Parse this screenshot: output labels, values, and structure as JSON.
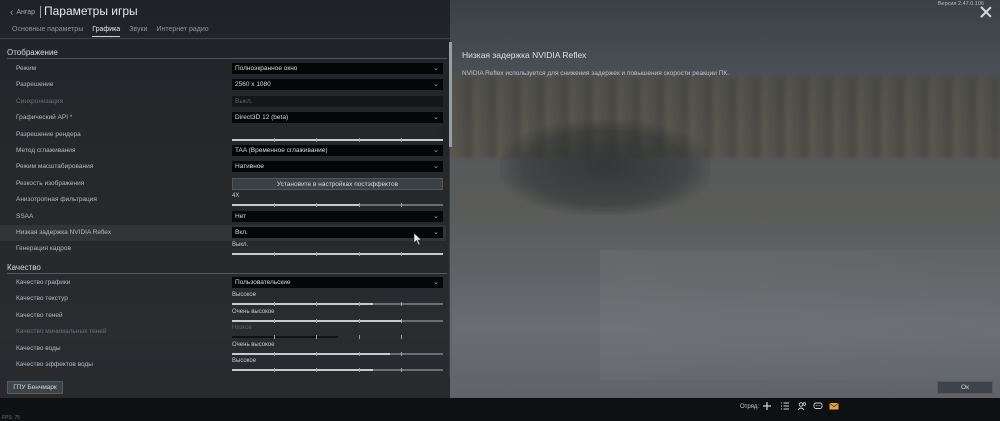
{
  "header": {
    "back_label": "Ангар",
    "title": "Параметры игры",
    "version": "Версия 2.47.0.106",
    "tabs": [
      {
        "label": "Основные параметры",
        "active": false
      },
      {
        "label": "Графика",
        "active": true
      },
      {
        "label": "Звуки",
        "active": false
      },
      {
        "label": "Интернет радио",
        "active": false
      }
    ]
  },
  "display_section": {
    "title": "Отображение",
    "rows": [
      {
        "label": "Режим",
        "type": "select",
        "value": "Полноэкранное окно"
      },
      {
        "label": "Разрешение",
        "type": "select",
        "value": "2560 x 1080"
      },
      {
        "label": "Синхронизация",
        "type": "select-disabled",
        "value": "Выкл."
      },
      {
        "label": "Графический API *",
        "type": "select",
        "value": "Direct3D 12 (beta)"
      },
      {
        "label": "Разрешение рендера",
        "type": "slider",
        "value": "",
        "level": 1.0
      },
      {
        "label": "Метод сглаживания",
        "type": "select",
        "value": "TAA (Временное сглаживание)"
      },
      {
        "label": "Режим масштабирования",
        "type": "select",
        "value": "Нативное"
      },
      {
        "label": "Резкость изображения",
        "type": "button",
        "value": "Установите в настройках постэффектов"
      },
      {
        "label": "Анизотропная фильтрация",
        "type": "slider",
        "value": "4X",
        "level": 0.6
      },
      {
        "label": "SSAA",
        "type": "select",
        "value": "Нет"
      },
      {
        "label": "Низкая задержка NVIDIA Reflex",
        "type": "select",
        "value": "Вкл.",
        "hover": true
      },
      {
        "label": "Генерация кадров",
        "type": "slider",
        "value": "Выкл.",
        "level": 1.0
      }
    ]
  },
  "quality_section": {
    "title": "Качество",
    "rows": [
      {
        "label": "Качество графики",
        "type": "select",
        "value": "Пользовательские"
      },
      {
        "label": "Качество текстур",
        "type": "slider",
        "value": "Высокое",
        "level": 0.67
      },
      {
        "label": "Качество теней",
        "type": "slider",
        "value": "Очень высокое",
        "level": 0.8
      },
      {
        "label": "Качество минимальных теней",
        "type": "slider-disabled",
        "value": "Низкое",
        "level": 0.5
      },
      {
        "label": "Качество воды",
        "type": "slider",
        "value": "Очень высокое",
        "level": 0.75
      },
      {
        "label": "Качество эффектов воды",
        "type": "slider",
        "value": "Высокое",
        "level": 0.67
      }
    ]
  },
  "info_panel": {
    "title": "Низкая задержка NVIDIA Reflex",
    "description": "NVIDIA Reflex используется для снижения задержек и повышения скорости реакции ПК."
  },
  "footer": {
    "benchmark_label": "ГПУ Бенчмарк",
    "ok_label": "Ок"
  },
  "taskbar": {
    "fps": "FPS: 75",
    "squad_label": "Отряд:",
    "icons": [
      "plus-icon",
      "list-icon",
      "people-icon",
      "chat-icon",
      "mail-icon"
    ]
  },
  "colors": {
    "panel_bg": "#181a1d",
    "select_bg": "#050607",
    "mail_accent": "#e8a24a"
  }
}
